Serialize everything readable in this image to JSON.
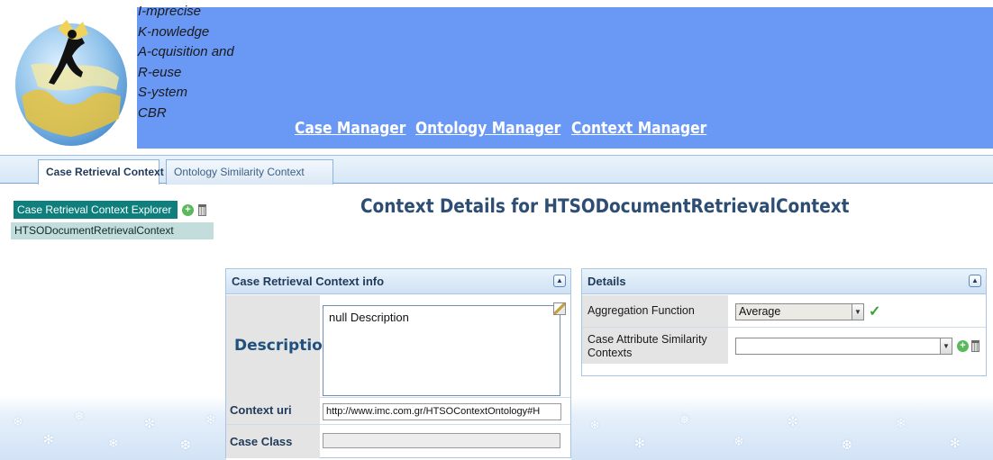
{
  "header": {
    "acronym_lines": [
      "I-mprecise",
      "K-nowledge",
      "A-cquisition and",
      "R-euse",
      "S-ystem",
      "CBR"
    ],
    "nav": [
      "Case Manager",
      "Ontology Manager",
      "Context Manager"
    ]
  },
  "tabs": {
    "active": "Case Retrieval Context",
    "inactive": "Ontology Similarity Context"
  },
  "explorer": {
    "title": "Case Retrieval Context Explorer",
    "items": [
      "HTSODocumentRetrievalContext"
    ]
  },
  "page_title": "Context Details for HTSODocumentRetrievalContext",
  "info_panel": {
    "title": "Case Retrieval Context info",
    "description_label": "Description",
    "description_value": "null Description",
    "uri_label": "Context uri",
    "uri_value": "http://www.imc.com.gr/HTSOContextOntology#H",
    "class_label": "Case Class",
    "class_value": ""
  },
  "details_panel": {
    "title": "Details",
    "aggregation_label": "Aggregation Function",
    "aggregation_value": "Average",
    "similarity_label": "Case Attribute Similarity Contexts",
    "similarity_value": ""
  },
  "colors": {
    "header_bg": "#6a99f5",
    "explorer_head": "#0f7f7d",
    "explorer_node": "#c3dddc",
    "title_text": "#2d4d73"
  }
}
